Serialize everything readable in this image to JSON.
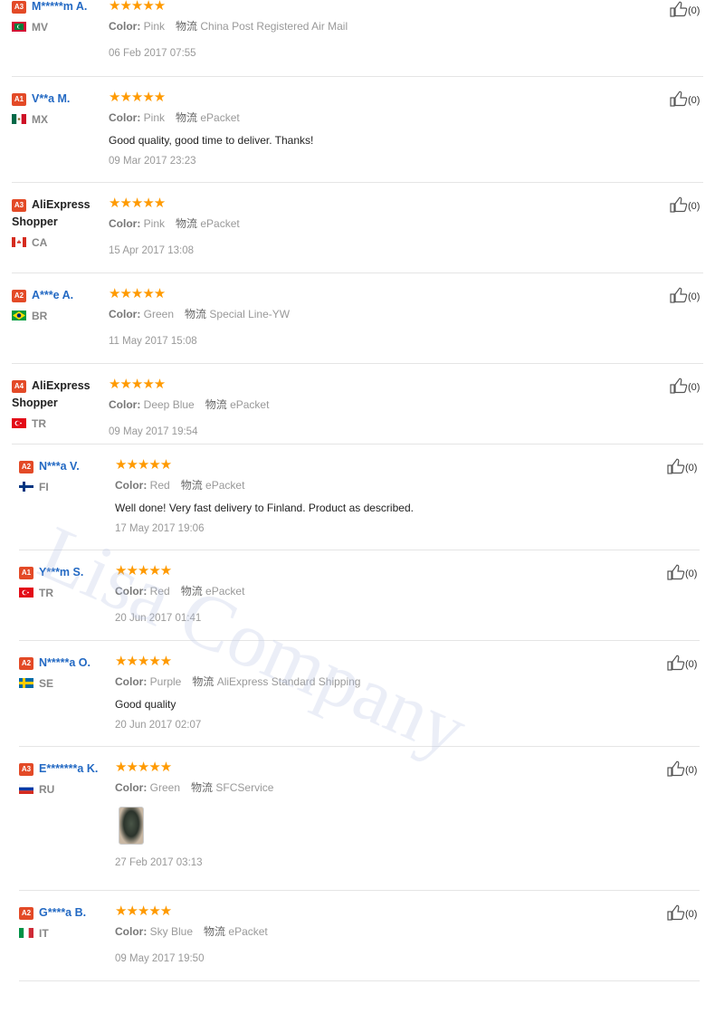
{
  "labels": {
    "color": "Color:",
    "shipping": "物流"
  },
  "watermark": "Lisa Company",
  "reviews": [
    {
      "level": "A3",
      "name": "M*****m A.",
      "country": "MV",
      "color": "Pink",
      "shipping": "China Post Registered Air Mail",
      "text": "",
      "date": "06 Feb 2017 07:55",
      "helpful": "(0)"
    },
    {
      "level": "A1",
      "name": "V**a M.",
      "country": "MX",
      "color": "Pink",
      "shipping": "ePacket",
      "text": "Good quality, good time to deliver. Thanks!",
      "date": "09 Mar 2017 23:23",
      "helpful": "(0)"
    },
    {
      "level": "A3",
      "name": "AliExpress Shopper",
      "country": "CA",
      "color": "Pink",
      "shipping": "ePacket",
      "text": "",
      "date": "15 Apr 2017 13:08",
      "helpful": "(0)"
    },
    {
      "level": "A2",
      "name": "A***e A.",
      "country": "BR",
      "color": "Green",
      "shipping": "Special Line-YW",
      "text": "",
      "date": "11 May 2017 15:08",
      "helpful": "(0)"
    },
    {
      "level": "A4",
      "name": "AliExpress Shopper",
      "country": "TR",
      "color": "Deep Blue",
      "shipping": "ePacket",
      "text": "",
      "date": "09 May 2017 19:54",
      "helpful": "(0)"
    },
    {
      "level": "A2",
      "name": "N***a V.",
      "country": "FI",
      "color": "Red",
      "shipping": "ePacket",
      "text": "Well done! Very fast delivery to Finland. Product as described.",
      "date": "17 May 2017 19:06",
      "helpful": "(0)"
    },
    {
      "level": "A1",
      "name": "Y***m S.",
      "country": "TR",
      "color": "Red",
      "shipping": "ePacket",
      "text": "",
      "date": "20 Jun 2017 01:41",
      "helpful": "(0)"
    },
    {
      "level": "A2",
      "name": "N*****a O.",
      "country": "SE",
      "color": "Purple",
      "shipping": "AliExpress Standard Shipping",
      "text": "Good quality",
      "date": "20 Jun 2017 02:07",
      "helpful": "(0)"
    },
    {
      "level": "A3",
      "name": "E*******a K.",
      "country": "RU",
      "color": "Green",
      "shipping": "SFCService",
      "text": "",
      "date": "27 Feb 2017 03:13",
      "helpful": "(0)"
    },
    {
      "level": "A2",
      "name": "G****a B.",
      "country": "IT",
      "color": "Sky Blue",
      "shipping": "ePacket",
      "text": "",
      "date": "09 May 2017 19:50",
      "helpful": "(0)"
    }
  ],
  "rating_stars": "★★★★★",
  "colors": {
    "accent_star": "#ff9a00",
    "badge": "#e34a27",
    "name_link": "#2369c3"
  },
  "icons": {
    "rating": "star-icon",
    "helpful": "thumbs-up-icon",
    "country": "flag-icon"
  }
}
